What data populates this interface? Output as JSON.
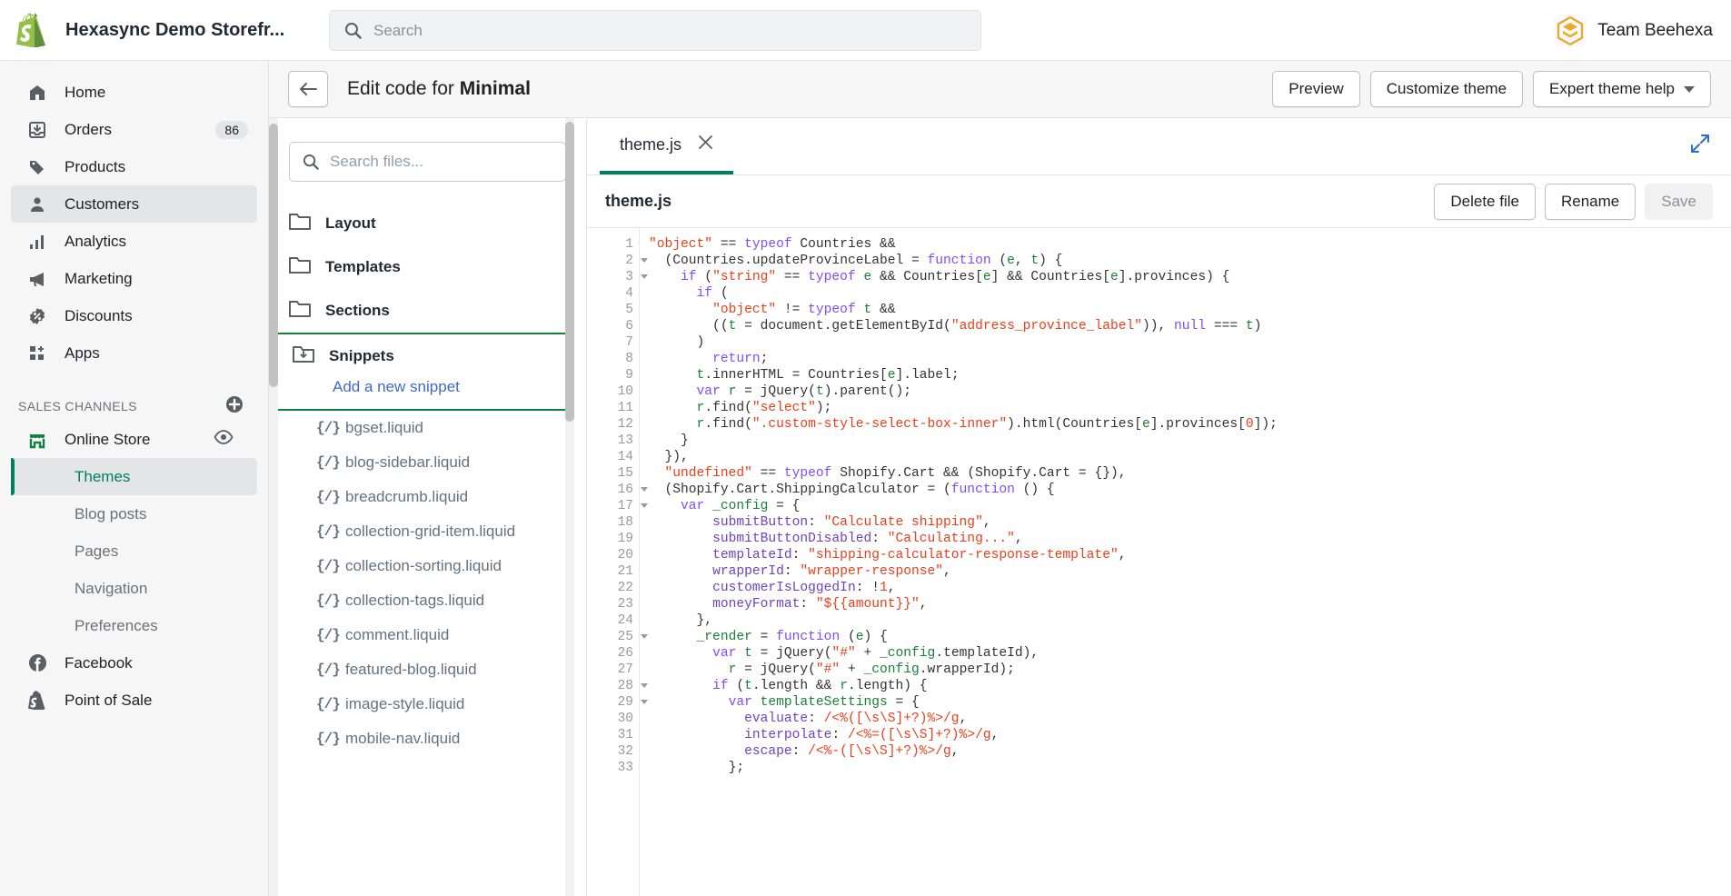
{
  "topbar": {
    "store_name": "Hexasync Demo Storefr...",
    "search_placeholder": "Search",
    "search_value": "",
    "account_name": "Team Beehexa",
    "brand_green": "#95bf47",
    "avatar_gold": "#e8ad28"
  },
  "sidebar": {
    "items": [
      {
        "label": "Home",
        "icon": "home-icon",
        "badge": "",
        "active": false
      },
      {
        "label": "Orders",
        "icon": "orders-icon",
        "badge": "86",
        "active": false
      },
      {
        "label": "Products",
        "icon": "products-icon",
        "badge": "",
        "active": false
      },
      {
        "label": "Customers",
        "icon": "customers-icon",
        "badge": "",
        "active": true
      },
      {
        "label": "Analytics",
        "icon": "analytics-icon",
        "badge": "",
        "active": false
      },
      {
        "label": "Marketing",
        "icon": "marketing-icon",
        "badge": "",
        "active": false
      },
      {
        "label": "Discounts",
        "icon": "discounts-icon",
        "badge": "",
        "active": false
      },
      {
        "label": "Apps",
        "icon": "apps-icon",
        "badge": "",
        "active": false
      }
    ],
    "section_title": "SALES CHANNELS",
    "online_store": "Online Store",
    "sub_items": [
      {
        "label": "Themes",
        "active": true
      },
      {
        "label": "Blog posts",
        "active": false
      },
      {
        "label": "Pages",
        "active": false
      },
      {
        "label": "Navigation",
        "active": false
      },
      {
        "label": "Preferences",
        "active": false
      }
    ],
    "channels": [
      {
        "label": "Facebook",
        "icon": "facebook-icon"
      },
      {
        "label": "Point of Sale",
        "icon": "pos-icon"
      }
    ],
    "active_green": "#008060"
  },
  "page_header": {
    "title_prefix": "Edit code for ",
    "theme_name": "Minimal",
    "buttons": [
      {
        "label": "Preview",
        "caret": false
      },
      {
        "label": "Customize theme",
        "caret": false
      },
      {
        "label": "Expert theme help",
        "caret": true
      }
    ]
  },
  "file_panel": {
    "search_placeholder": "Search files...",
    "search_value": "",
    "folders": [
      {
        "name": "Layout",
        "expanded": false
      },
      {
        "name": "Templates",
        "expanded": false
      },
      {
        "name": "Sections",
        "expanded": false
      }
    ],
    "snippets_folder": "Snippets",
    "add_link": "Add a new snippet",
    "highlight_color": "#108043",
    "files": [
      "bgset.liquid",
      "blog-sidebar.liquid",
      "breadcrumb.liquid",
      "collection-grid-item.liquid",
      "collection-sorting.liquid",
      "collection-tags.liquid",
      "comment.liquid",
      "featured-blog.liquid",
      "image-style.liquid",
      "mobile-nav.liquid"
    ],
    "file_glyph": "{/}"
  },
  "editor": {
    "tab_label": "theme.js",
    "tab_close": "×",
    "file_name": "theme.js",
    "actions": [
      {
        "label": "Delete file",
        "disabled": false
      },
      {
        "label": "Rename",
        "disabled": false
      },
      {
        "label": "Save",
        "disabled": true
      }
    ],
    "fold_lines": [
      2,
      3,
      16,
      17,
      25,
      28,
      29
    ],
    "first_line": 1,
    "last_line": 33,
    "lines": [
      [
        [
          "s",
          "\"object\""
        ],
        [
          "pl",
          " == "
        ],
        [
          "k",
          "typeof"
        ],
        [
          "pl",
          " Countries &&"
        ]
      ],
      [
        [
          "pl",
          "  ("
        ],
        [
          "pl",
          "Countries.updateProvinceLabel = "
        ],
        [
          "k",
          "function"
        ],
        [
          "pl",
          " ("
        ],
        [
          "p",
          "e"
        ],
        [
          "pl",
          ", "
        ],
        [
          "p",
          "t"
        ],
        [
          "pl",
          ") {"
        ]
      ],
      [
        [
          "pl",
          "    "
        ],
        [
          "k",
          "if"
        ],
        [
          "pl",
          " ("
        ],
        [
          "s",
          "\"string\""
        ],
        [
          "pl",
          " == "
        ],
        [
          "k",
          "typeof"
        ],
        [
          "pl",
          " "
        ],
        [
          "p",
          "e"
        ],
        [
          "pl",
          " && Countries["
        ],
        [
          "p",
          "e"
        ],
        [
          "pl",
          "] && Countries["
        ],
        [
          "p",
          "e"
        ],
        [
          "pl",
          "].provinces) {"
        ]
      ],
      [
        [
          "pl",
          "      "
        ],
        [
          "k",
          "if"
        ],
        [
          "pl",
          " ("
        ]
      ],
      [
        [
          "pl",
          "        "
        ],
        [
          "s",
          "\"object\""
        ],
        [
          "pl",
          " != "
        ],
        [
          "k",
          "typeof"
        ],
        [
          "pl",
          " "
        ],
        [
          "p",
          "t"
        ],
        [
          "pl",
          " &&"
        ]
      ],
      [
        [
          "pl",
          "        (("
        ],
        [
          "p",
          "t"
        ],
        [
          "pl",
          " = document.getElementById("
        ],
        [
          "s",
          "\"address_province_label\""
        ],
        [
          "pl",
          ")), "
        ],
        [
          "k",
          "null"
        ],
        [
          "pl",
          " === "
        ],
        [
          "p",
          "t"
        ],
        [
          "pl",
          ")"
        ]
      ],
      [
        [
          "pl",
          "      )"
        ]
      ],
      [
        [
          "pl",
          "        "
        ],
        [
          "k",
          "return"
        ],
        [
          "pl",
          ";"
        ]
      ],
      [
        [
          "pl",
          "      "
        ],
        [
          "p",
          "t"
        ],
        [
          "pl",
          ".innerHTML = Countries["
        ],
        [
          "p",
          "e"
        ],
        [
          "pl",
          "].label;"
        ]
      ],
      [
        [
          "pl",
          "      "
        ],
        [
          "k",
          "var"
        ],
        [
          "pl",
          " "
        ],
        [
          "p",
          "r"
        ],
        [
          "pl",
          " = jQuery("
        ],
        [
          "p",
          "t"
        ],
        [
          "pl",
          ").parent();"
        ]
      ],
      [
        [
          "pl",
          "      "
        ],
        [
          "p",
          "r"
        ],
        [
          "pl",
          ".find("
        ],
        [
          "s",
          "\"select\""
        ],
        [
          "pl",
          ");"
        ]
      ],
      [
        [
          "pl",
          "      "
        ],
        [
          "p",
          "r"
        ],
        [
          "pl",
          ".find("
        ],
        [
          "s",
          "\".custom-style-select-box-inner\""
        ],
        [
          "pl",
          ").html(Countries["
        ],
        [
          "p",
          "e"
        ],
        [
          "pl",
          "].provinces["
        ],
        [
          "n",
          "0"
        ],
        [
          "pl",
          "]);"
        ]
      ],
      [
        [
          "pl",
          "    }"
        ]
      ],
      [
        [
          "pl",
          "  }),"
        ]
      ],
      [
        [
          "pl",
          "  "
        ],
        [
          "s",
          "\"undefined\""
        ],
        [
          "pl",
          " == "
        ],
        [
          "k",
          "typeof"
        ],
        [
          "pl",
          " Shopify.Cart && (Shopify.Cart = {}),"
        ]
      ],
      [
        [
          "pl",
          "  (Shopify.Cart.ShippingCalculator = ("
        ],
        [
          "k",
          "function"
        ],
        [
          "pl",
          " () {"
        ]
      ],
      [
        [
          "pl",
          "    "
        ],
        [
          "k",
          "var"
        ],
        [
          "pl",
          " "
        ],
        [
          "g",
          "_config"
        ],
        [
          "pl",
          " = {"
        ]
      ],
      [
        [
          "pl",
          "        "
        ],
        [
          "pr",
          "submitButton"
        ],
        [
          "pl",
          ": "
        ],
        [
          "s",
          "\"Calculate shipping\""
        ],
        [
          "pl",
          ","
        ]
      ],
      [
        [
          "pl",
          "        "
        ],
        [
          "pr",
          "submitButtonDisabled"
        ],
        [
          "pl",
          ": "
        ],
        [
          "s",
          "\"Calculating...\""
        ],
        [
          "pl",
          ","
        ]
      ],
      [
        [
          "pl",
          "        "
        ],
        [
          "pr",
          "templateId"
        ],
        [
          "pl",
          ": "
        ],
        [
          "s",
          "\"shipping-calculator-response-template\""
        ],
        [
          "pl",
          ","
        ]
      ],
      [
        [
          "pl",
          "        "
        ],
        [
          "pr",
          "wrapperId"
        ],
        [
          "pl",
          ": "
        ],
        [
          "s",
          "\"wrapper-response\""
        ],
        [
          "pl",
          ","
        ]
      ],
      [
        [
          "pl",
          "        "
        ],
        [
          "pr",
          "customerIsLoggedIn"
        ],
        [
          "pl",
          ": !"
        ],
        [
          "n",
          "1"
        ],
        [
          "pl",
          ","
        ]
      ],
      [
        [
          "pl",
          "        "
        ],
        [
          "pr",
          "moneyFormat"
        ],
        [
          "pl",
          ": "
        ],
        [
          "s",
          "\"${{amount}}\""
        ],
        [
          "pl",
          ","
        ]
      ],
      [
        [
          "pl",
          "      },"
        ]
      ],
      [
        [
          "pl",
          "      "
        ],
        [
          "g",
          "_render"
        ],
        [
          "pl",
          " = "
        ],
        [
          "k",
          "function"
        ],
        [
          "pl",
          " ("
        ],
        [
          "p",
          "e"
        ],
        [
          "pl",
          ") {"
        ]
      ],
      [
        [
          "pl",
          "        "
        ],
        [
          "k",
          "var"
        ],
        [
          "pl",
          " "
        ],
        [
          "p",
          "t"
        ],
        [
          "pl",
          " = jQuery("
        ],
        [
          "s",
          "\"#\""
        ],
        [
          "pl",
          " + "
        ],
        [
          "g",
          "_config"
        ],
        [
          "pl",
          ".templateId),"
        ]
      ],
      [
        [
          "pl",
          "          "
        ],
        [
          "p",
          "r"
        ],
        [
          "pl",
          " = jQuery("
        ],
        [
          "s",
          "\"#\""
        ],
        [
          "pl",
          " + "
        ],
        [
          "g",
          "_config"
        ],
        [
          "pl",
          ".wrapperId);"
        ]
      ],
      [
        [
          "pl",
          "        "
        ],
        [
          "k",
          "if"
        ],
        [
          "pl",
          " ("
        ],
        [
          "p",
          "t"
        ],
        [
          "pl",
          ".length && "
        ],
        [
          "p",
          "r"
        ],
        [
          "pl",
          ".length) {"
        ]
      ],
      [
        [
          "pl",
          "          "
        ],
        [
          "k",
          "var"
        ],
        [
          "pl",
          " "
        ],
        [
          "g",
          "templateSettings"
        ],
        [
          "pl",
          " = {"
        ]
      ],
      [
        [
          "pl",
          "            "
        ],
        [
          "pr",
          "evaluate"
        ],
        [
          "pl",
          ": "
        ],
        [
          "n",
          "/<%([\\s\\S]+?)%>/g"
        ],
        [
          "pl",
          ","
        ]
      ],
      [
        [
          "pl",
          "            "
        ],
        [
          "pr",
          "interpolate"
        ],
        [
          "pl",
          ": "
        ],
        [
          "n",
          "/<%=([\\s\\S]+?)%>/g"
        ],
        [
          "pl",
          ","
        ]
      ],
      [
        [
          "pl",
          "            "
        ],
        [
          "pr",
          "escape"
        ],
        [
          "pl",
          ": "
        ],
        [
          "n",
          "/<%-([\\s\\S]+?)%>/g"
        ],
        [
          "pl",
          ","
        ]
      ],
      [
        [
          "pl",
          "          };"
        ]
      ]
    ]
  }
}
